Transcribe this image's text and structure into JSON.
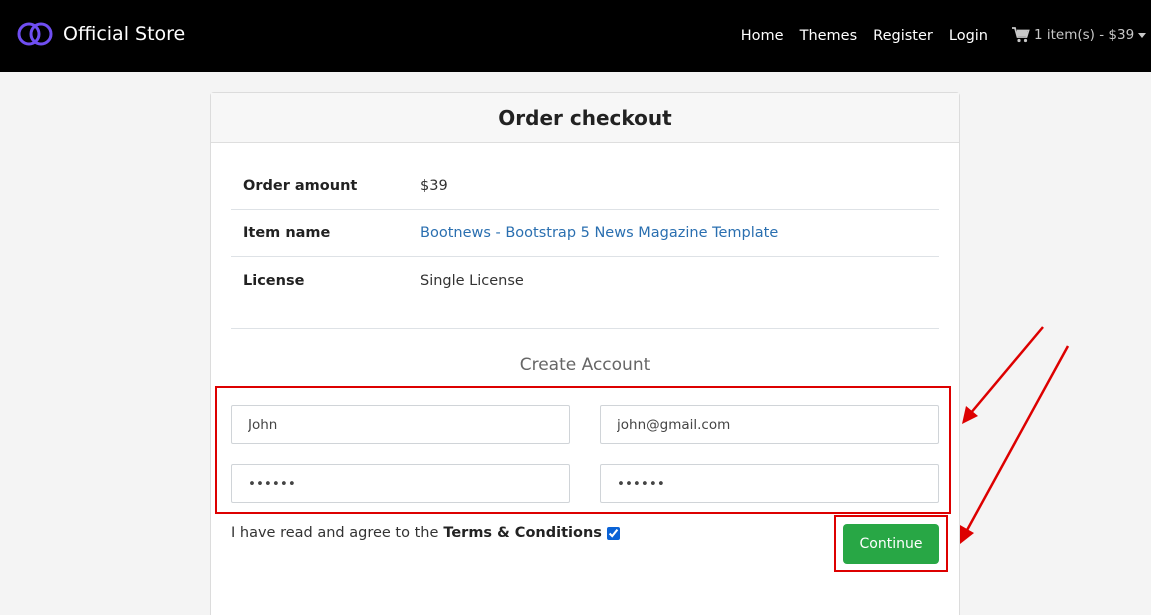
{
  "navbar": {
    "brand": "Official Store",
    "links": [
      "Home",
      "Themes",
      "Register",
      "Login"
    ],
    "cart_label": "1 item(s) - $39"
  },
  "checkout": {
    "title": "Order checkout",
    "rows": [
      {
        "label": "Order amount",
        "value": "$39"
      },
      {
        "label": "Item name",
        "value": "Bootnews - Bootstrap 5 News Magazine Template"
      },
      {
        "label": "License",
        "value": "Single License"
      }
    ],
    "create_account_title": "Create Account",
    "form": {
      "name_value": "John",
      "email_value": "john@gmail.com",
      "password_value": "••••••",
      "confirm_password_value": "••••••"
    },
    "terms_text": "I have read and agree to the",
    "terms_strong": "Terms & Conditions",
    "terms_checked": true,
    "continue_label": "Continue"
  },
  "colors": {
    "navbar_bg": "#000000",
    "brand_logo": "#6f4ef2",
    "link": "#2a6fb0",
    "continue_bg": "#28a745",
    "annotation": "#dd0000"
  }
}
